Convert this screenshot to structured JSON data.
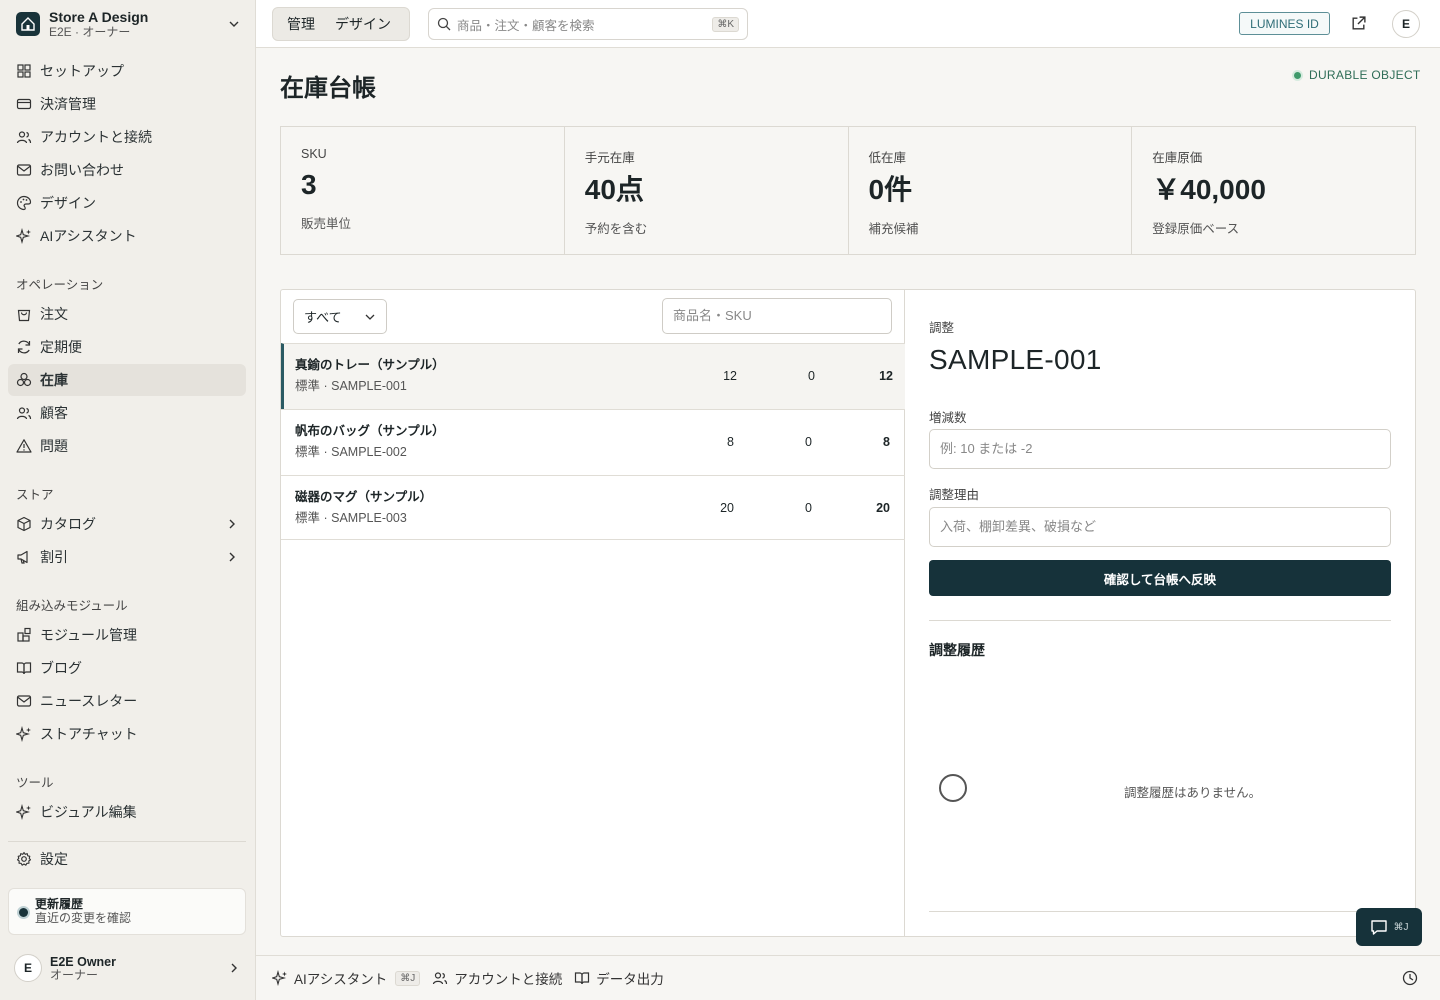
{
  "store": {
    "name": "Store A Design",
    "sub": "E2E · オーナー"
  },
  "sidebar": {
    "top_items": [
      {
        "label": "セットアップ",
        "icon": "grid-icon"
      },
      {
        "label": "決済管理",
        "icon": "card-icon"
      },
      {
        "label": "アカウントと接続",
        "icon": "users-icon"
      },
      {
        "label": "お問い合わせ",
        "icon": "mail-icon"
      },
      {
        "label": "デザイン",
        "icon": "palette-icon"
      },
      {
        "label": "AIアシスタント",
        "icon": "sparkle-icon"
      }
    ],
    "operations_title": "オペレーション",
    "operations_items": [
      {
        "label": "注文",
        "icon": "bag-icon"
      },
      {
        "label": "定期便",
        "icon": "refresh-icon"
      },
      {
        "label": "在庫",
        "icon": "boxes-icon",
        "active": true
      },
      {
        "label": "顧客",
        "icon": "users-icon"
      },
      {
        "label": "問題",
        "icon": "warning-icon"
      }
    ],
    "store_title": "ストア",
    "store_items": [
      {
        "label": "カタログ",
        "icon": "package-icon"
      },
      {
        "label": "割引",
        "icon": "megaphone-icon"
      }
    ],
    "modules_title": "組み込みモジュール",
    "modules_items": [
      {
        "label": "モジュール管理",
        "icon": "blocks-icon"
      },
      {
        "label": "ブログ",
        "icon": "book-icon"
      },
      {
        "label": "ニュースレター",
        "icon": "mail-icon"
      },
      {
        "label": "ストアチャット",
        "icon": "sparkle-icon"
      }
    ],
    "tools_title": "ツール",
    "tools_items": [
      {
        "label": "ビジュアル編集",
        "icon": "sparkle-icon"
      }
    ],
    "settings_label": "設定",
    "update": {
      "title": "更新履歴",
      "sub": "直近の変更を確認"
    },
    "user": {
      "initial": "E",
      "name": "E2E Owner",
      "role": "オーナー"
    }
  },
  "topbar": {
    "tabs": [
      "管理",
      "デザイン"
    ],
    "search_placeholder": "商品・注文・顧客を検索",
    "search_kbd": "⌘K",
    "lumines": "LUMINES ID",
    "avatar": "E"
  },
  "page": {
    "title": "在庫台帳",
    "badge": "DURABLE OBJECT"
  },
  "stats": [
    {
      "label": "SKU",
      "value": "3",
      "sub": "販売単位"
    },
    {
      "label": "手元在庫",
      "value": "40点",
      "sub": "予約を含む"
    },
    {
      "label": "低在庫",
      "value": "0件",
      "sub": "補充候補"
    },
    {
      "label": "在庫原価",
      "value": "￥40,000",
      "sub": "登録原価ベース"
    }
  ],
  "list": {
    "filter": "すべて",
    "search_placeholder": "商品名・SKU",
    "rows": [
      {
        "name": "真鍮のトレー（サンプル）",
        "sub": "標準 · SAMPLE-001",
        "a": "12",
        "b": "0",
        "c": "12"
      },
      {
        "name": "帆布のバッグ（サンプル）",
        "sub": "標準 · SAMPLE-002",
        "a": "8",
        "b": "0",
        "c": "8"
      },
      {
        "name": "磁器のマグ（サンプル）",
        "sub": "標準 · SAMPLE-003",
        "a": "20",
        "b": "0",
        "c": "20"
      }
    ]
  },
  "adjust": {
    "label": "調整",
    "sku": "SAMPLE-001",
    "qty_label": "増減数",
    "qty_placeholder": "例: 10 または -2",
    "reason_label": "調整理由",
    "reason_placeholder": "入荷、棚卸差異、破損など",
    "submit": "確認して台帳へ反映",
    "history_title": "調整履歴",
    "history_empty": "調整履歴はありません。"
  },
  "bottombar": {
    "ai": "AIアシスタント",
    "ai_kbd": "⌘J",
    "accounts": "アカウントと接続",
    "export": "データ出力"
  },
  "chat": {
    "kbd": "⌘J"
  }
}
